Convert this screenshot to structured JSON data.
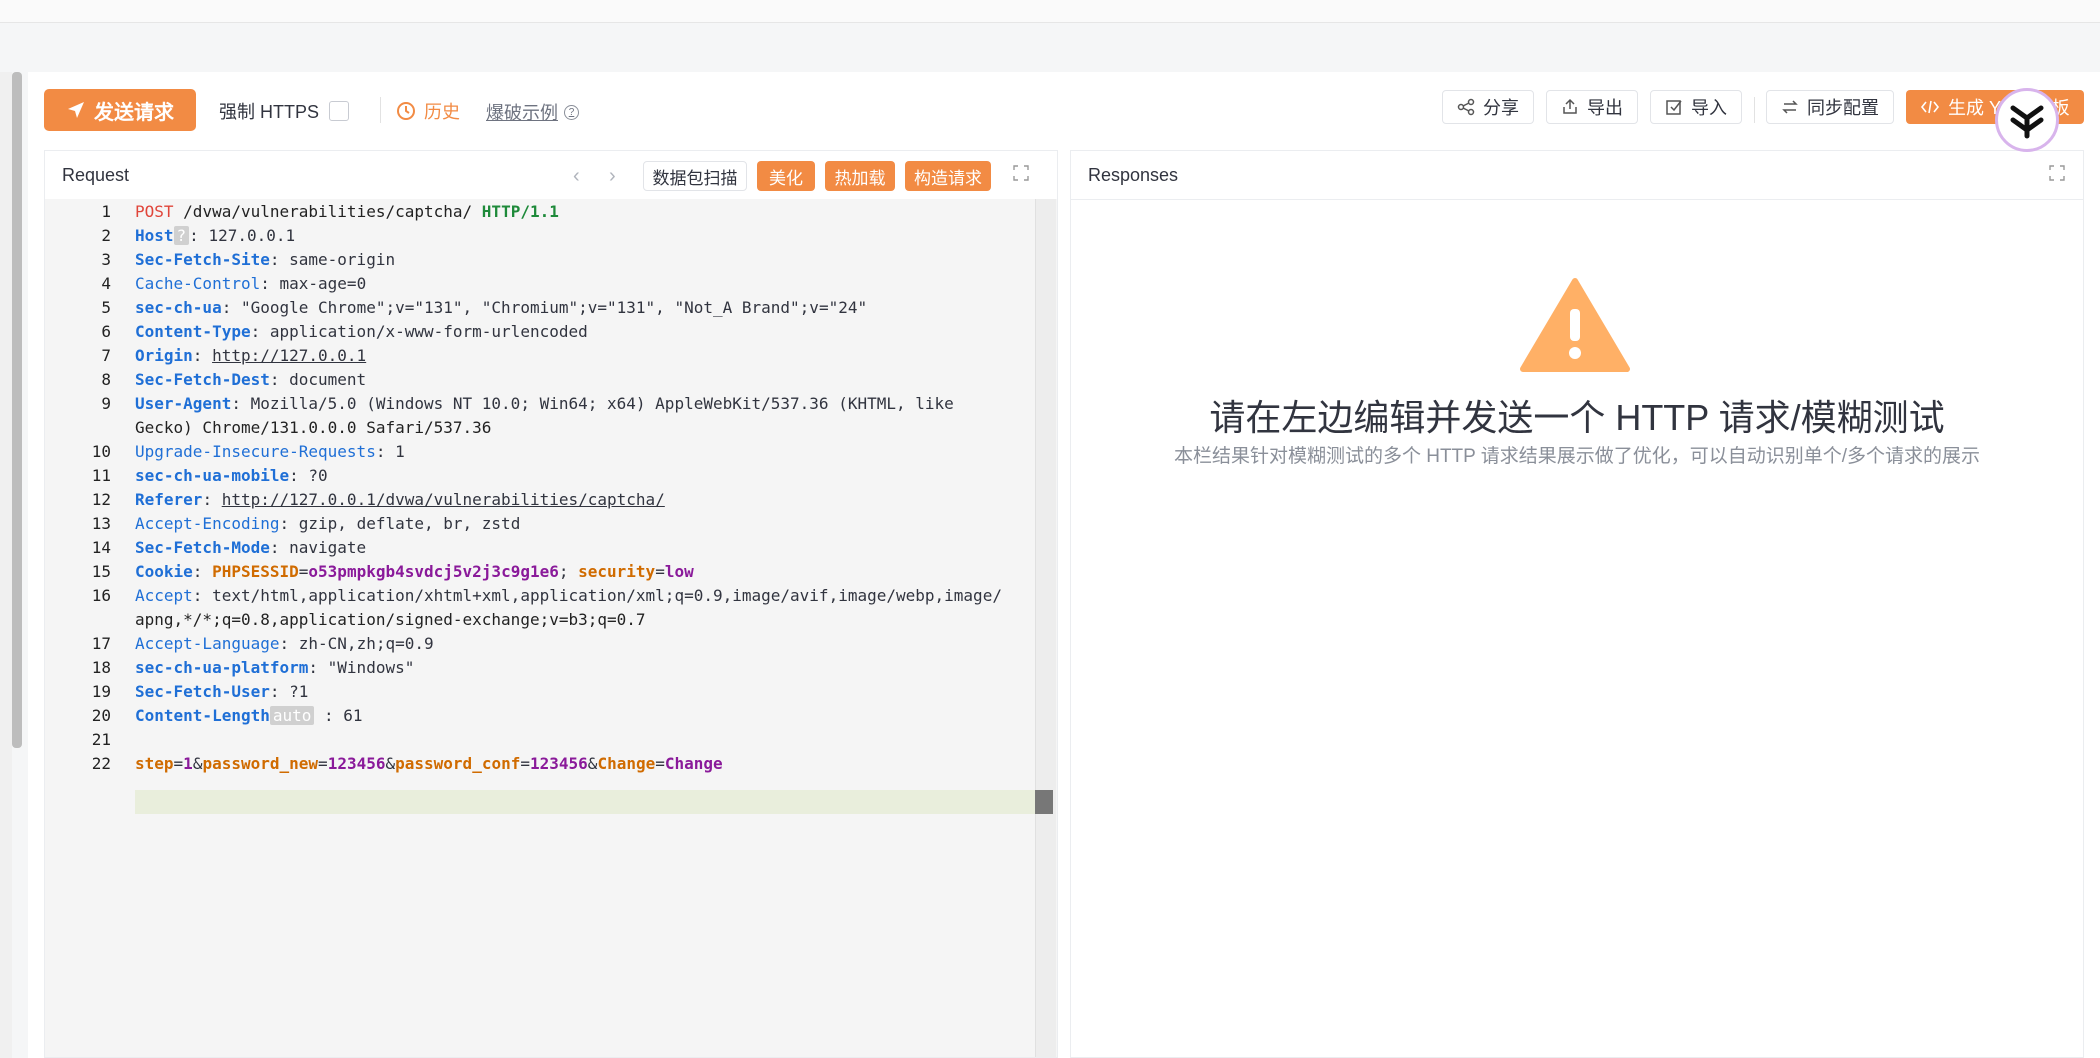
{
  "toolbar": {
    "send_label": "发送请求",
    "force_https_label": "强制 HTTPS",
    "history_label": "历史",
    "fuzz_example_label": "爆破示例",
    "share_label": "分享",
    "export_label": "导出",
    "import_label": "导入",
    "sync_label": "同步配置",
    "yaml_label": "生成 Yaml 模板"
  },
  "request": {
    "title": "Request",
    "scan_label": "数据包扫描",
    "beautify_label": "美化",
    "hotload_label": "热加载",
    "build_label": "构造请求",
    "lines": [
      {
        "n": "1",
        "text": "POST /dvwa/vulnerabilities/captcha/ HTTP/1.1"
      },
      {
        "n": "2",
        "text": "Host  : 127.0.0.1"
      },
      {
        "n": "3",
        "text": "Sec-Fetch-Site: same-origin"
      },
      {
        "n": "4",
        "text": "Cache-Control: max-age=0"
      },
      {
        "n": "5",
        "text": "sec-ch-ua: \"Google Chrome\";v=\"131\", \"Chromium\";v=\"131\", \"Not_A Brand\";v=\"24\""
      },
      {
        "n": "6",
        "text": "Content-Type: application/x-www-form-urlencoded"
      },
      {
        "n": "7",
        "text": "Origin: http://127.0.0.1"
      },
      {
        "n": "8",
        "text": "Sec-Fetch-Dest: document"
      },
      {
        "n": "9",
        "text": "User-Agent: Mozilla/5.0 (Windows NT 10.0; Win64; x64) AppleWebKit/537.36 (KHTML, like"
      },
      {
        "n": "",
        "text": "Gecko) Chrome/131.0.0.0 Safari/537.36"
      },
      {
        "n": "10",
        "text": "Upgrade-Insecure-Requests: 1"
      },
      {
        "n": "11",
        "text": "sec-ch-ua-mobile: ?0"
      },
      {
        "n": "12",
        "text": "Referer: http://127.0.0.1/dvwa/vulnerabilities/captcha/"
      },
      {
        "n": "13",
        "text": "Accept-Encoding: gzip, deflate, br, zstd"
      },
      {
        "n": "14",
        "text": "Sec-Fetch-Mode: navigate"
      },
      {
        "n": "15",
        "text": "Cookie: PHPSESSID=o53pmpkgb4svdcj5v2j3c9g1e6; security=low"
      },
      {
        "n": "16",
        "text": "Accept: text/html,application/xhtml+xml,application/xml;q=0.9,image/avif,image/webp,image/"
      },
      {
        "n": "",
        "text": "apng,*/*;q=0.8,application/signed-exchange;v=b3;q=0.7"
      },
      {
        "n": "17",
        "text": "Accept-Language: zh-CN,zh;q=0.9"
      },
      {
        "n": "18",
        "text": "sec-ch-ua-platform: \"Windows\""
      },
      {
        "n": "19",
        "text": "Sec-Fetch-User: ?1"
      },
      {
        "n": "20",
        "text": "Content-Length auto : 61"
      },
      {
        "n": "21",
        "text": ""
      },
      {
        "n": "22",
        "text": "step=1&password_new=123456&password_conf=123456&Change=Change"
      }
    ]
  },
  "response": {
    "title": "Responses",
    "empty_title": "请在左边编辑并发送一个 HTTP 请求/模糊测试",
    "empty_desc": "本栏结果针对模糊测试的多个 HTTP 请求结果展示做了优化，可以自动识别单个/多个请求的展示"
  },
  "colors": {
    "accent": "#f28b44",
    "warning": "#ffb066"
  }
}
